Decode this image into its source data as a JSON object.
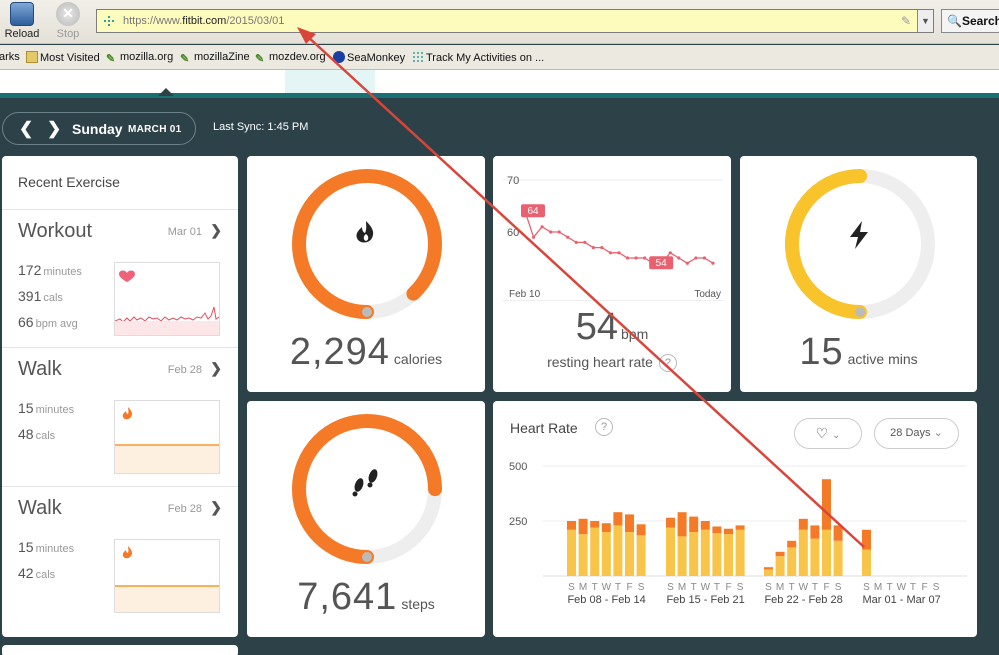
{
  "browser": {
    "reload_label": "Reload",
    "stop_label": "Stop",
    "url_prefix": "https://www.",
    "url_domain": "fitbit.com",
    "url_path": "/2015/03/01",
    "search_label": "Search",
    "bookmarks": [
      "arks",
      "Most Visited",
      "mozilla.org",
      "mozillaZine",
      "mozdev.org",
      "SeaMonkey",
      "Track My Activities on ..."
    ]
  },
  "date_nav": {
    "day": "Sunday",
    "month_date": "MARCH 01",
    "last_sync": "Last Sync: 1:45 PM"
  },
  "recent_exercise": {
    "title": "Recent Exercise",
    "items": [
      {
        "name": "Workout",
        "date": "Mar 01",
        "stats": [
          {
            "value": "172",
            "unit": "minutes"
          },
          {
            "value": "391",
            "unit": "cals"
          },
          {
            "value": "66",
            "unit": "bpm avg"
          }
        ]
      },
      {
        "name": "Walk",
        "date": "Feb 28",
        "stats": [
          {
            "value": "15",
            "unit": "minutes"
          },
          {
            "value": "48",
            "unit": "cals"
          }
        ]
      },
      {
        "name": "Walk",
        "date": "Feb 28",
        "stats": [
          {
            "value": "15",
            "unit": "minutes"
          },
          {
            "value": "42",
            "unit": "cals"
          }
        ]
      }
    ]
  },
  "calories": {
    "value": "2,294",
    "unit": "calories",
    "progress": 0.88,
    "color": "#f47a28",
    "icon": "flame-icon"
  },
  "steps": {
    "value": "7,641",
    "unit": "steps",
    "progress": 0.75,
    "color": "#f47a28",
    "icon": "footsteps-icon"
  },
  "active": {
    "value": "15",
    "unit": "active mins",
    "progress": 0.5,
    "color": "#f9c32b",
    "icon": "lightning-icon"
  },
  "resting_hr": {
    "value": "54",
    "unit": "bpm",
    "label": "resting heart rate",
    "help": "?",
    "chart_data": {
      "type": "line",
      "y_tick": "70",
      "y_tick2": "60",
      "x_start": "Feb 10",
      "x_end": "Today",
      "start_badge": "64",
      "end_badge": "54",
      "values": [
        64,
        59,
        61,
        60,
        60,
        59,
        58,
        58,
        57,
        57,
        56,
        56,
        55,
        55,
        55,
        54,
        54,
        56,
        55,
        54,
        55,
        55,
        54
      ]
    }
  },
  "heart_rate": {
    "title": "Heart Rate",
    "help": "?",
    "heart_button": "heart-icon",
    "range_button": "28 Days",
    "chart_data": {
      "type": "bar",
      "yticks": [
        "500",
        "250"
      ],
      "day_letters": [
        "S",
        "M",
        "T",
        "W",
        "T",
        "F",
        "S"
      ],
      "weeks": [
        "Feb 08 - Feb 14",
        "Feb 15 - Feb 21",
        "Feb 22 - Feb 28",
        "Mar 01 - Mar 07"
      ],
      "series": [
        {
          "name": "",
          "color": "#f9c44a",
          "values": [
            210,
            190,
            220,
            200,
            230,
            200,
            185,
            220,
            180,
            200,
            210,
            195,
            190,
            210,
            30,
            90,
            130,
            210,
            170,
            210,
            160,
            120,
            0,
            0,
            0,
            0,
            0,
            0
          ]
        },
        {
          "name": "",
          "color": "#f47a28",
          "values": [
            40,
            70,
            30,
            40,
            60,
            80,
            50,
            45,
            110,
            70,
            40,
            30,
            25,
            20,
            10,
            20,
            30,
            50,
            60,
            230,
            70,
            90,
            0,
            0,
            0,
            0,
            0,
            0
          ]
        }
      ]
    }
  }
}
